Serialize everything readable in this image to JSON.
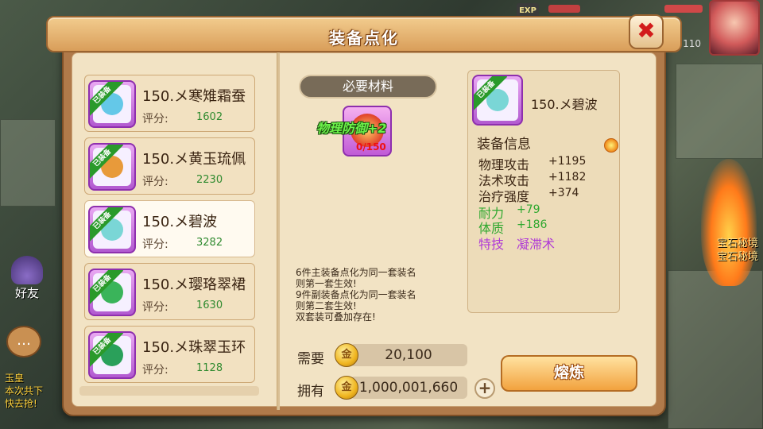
{
  "window": {
    "title": "装备点化"
  },
  "close_button": {
    "label": "✖"
  },
  "hud": {
    "exp_label": "EXP",
    "level": "110"
  },
  "background": {
    "friend_label": "好友",
    "map_labels": [
      "宝石秘境",
      "宝石秘境"
    ],
    "chat_lines": [
      "玉皇",
      "本次共下",
      "快去抢!"
    ]
  },
  "equipment_list": [
    {
      "badge": "已装备",
      "name": "150.メ寒雉霜蚕",
      "score_label": "评分:",
      "score": "1602",
      "gem_color": "#64c8e8"
    },
    {
      "badge": "已装备",
      "name": "150.メ黄玉琉佩",
      "score_label": "评分:",
      "score": "2230",
      "gem_color": "#e89a3a"
    },
    {
      "badge": "已装备",
      "name": "150.メ碧波",
      "score_label": "评分:",
      "score": "3282",
      "gem_color": "#7ad6d6"
    },
    {
      "badge": "已装备",
      "name": "150.メ璎珞翠裙",
      "score_label": "评分:",
      "score": "1630",
      "gem_color": "#3ab45a"
    },
    {
      "badge": "已装备",
      "name": "150.メ珠翠玉环",
      "score_label": "评分:",
      "score": "1128",
      "gem_color": "#2aa05a"
    }
  ],
  "materials": {
    "title": "必要材料",
    "item_label": "物理防御+2",
    "count": "0/150"
  },
  "notes": [
    "6件主装备点化为同一套装名",
    "则第一套生效!",
    "9件副装备点化为同一套装名",
    "则第二套生效!",
    "双套装可叠加存在!"
  ],
  "cost": {
    "need_label": "需要",
    "need_value": "20,100",
    "have_label": "拥有",
    "have_value": "1,000,001,660",
    "coin_glyph": "金",
    "plus_label": "+"
  },
  "smelt_button": {
    "label": "熔炼"
  },
  "info": {
    "item_name": "150.メ碧波",
    "badge": "已装备",
    "header": "装备信息",
    "stats": [
      {
        "name": "物理攻击",
        "value": "+1195",
        "color": "#3a2412"
      },
      {
        "name": "法术攻击",
        "value": "+1182",
        "color": "#3a2412"
      },
      {
        "name": "治疗强度",
        "value": "+374",
        "color": "#3a2412"
      },
      {
        "name": "耐力",
        "value": "+79",
        "color": "#2fa82f"
      },
      {
        "name": "体质",
        "value": "+186",
        "color": "#2fa82f"
      },
      {
        "name": "特技",
        "value": "凝滞术",
        "color": "#b03ad6"
      }
    ]
  },
  "colors": {
    "selected_item_bg": "#fffaf0",
    "score_green": "#2f8a2f",
    "title_orange": "#d99e5a"
  }
}
